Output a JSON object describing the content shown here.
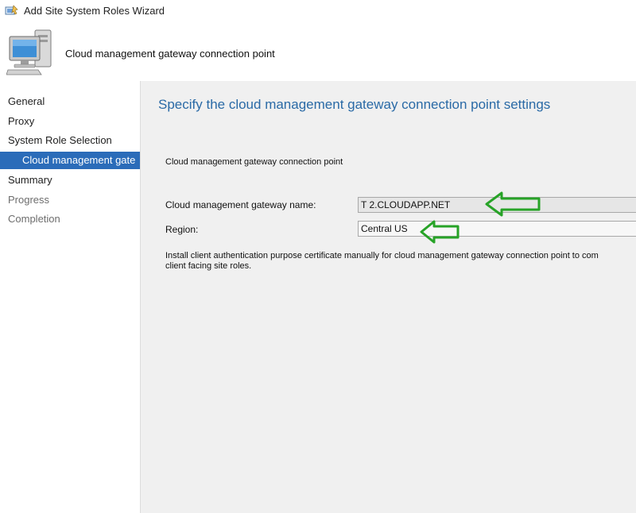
{
  "window": {
    "title": "Add Site System Roles Wizard"
  },
  "header": {
    "heading": "Cloud management gateway connection point"
  },
  "nav": {
    "items": [
      {
        "label": "General",
        "state": "normal"
      },
      {
        "label": "Proxy",
        "state": "normal"
      },
      {
        "label": "System Role Selection",
        "state": "normal"
      },
      {
        "label": "Cloud management gate",
        "state": "active"
      },
      {
        "label": "Summary",
        "state": "normal"
      },
      {
        "label": "Progress",
        "state": "disabled"
      },
      {
        "label": "Completion",
        "state": "disabled"
      }
    ]
  },
  "main": {
    "title": "Specify the cloud management gateway connection point settings",
    "section_label": "Cloud management gateway connection point",
    "gateway_name_label": "Cloud management gateway name:",
    "gateway_name_value": "T      2.CLOUDAPP.NET",
    "region_label": "Region:",
    "region_value": "Central US",
    "info_line1": "Install client authentication purpose certificate manually for cloud management gateway connection point to com",
    "info_line2": "client facing site roles."
  },
  "colors": {
    "accent": "#2b6cb9",
    "title_blue": "#2a6aa6",
    "arrow_green": "#27a327"
  }
}
